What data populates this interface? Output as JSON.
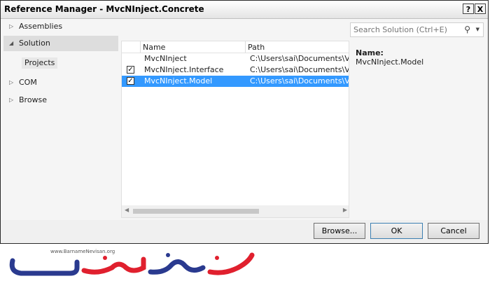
{
  "window": {
    "title": "Reference Manager - MvcNInject.Concrete",
    "help_btn": "?",
    "close_btn": "X"
  },
  "nav": {
    "items": [
      {
        "label": "Assemblies",
        "arrow": "▷"
      },
      {
        "label": "Solution",
        "arrow": "◢"
      },
      {
        "label": "COM",
        "arrow": "▷"
      },
      {
        "label": "Browse",
        "arrow": "▷"
      }
    ],
    "sub_item": "Projects"
  },
  "list": {
    "columns": [
      "Name",
      "Path"
    ],
    "rows": [
      {
        "checked": false,
        "name": "MvcNInject",
        "path": "C:\\Users\\sai\\Documents\\Visua"
      },
      {
        "checked": true,
        "name": "MvcNInject.Interface",
        "path": "C:\\Users\\sai\\Documents\\Visua"
      },
      {
        "checked": true,
        "name": "MvcNInject.Model",
        "path": "C:\\Users\\sai\\Documents\\Visua"
      }
    ],
    "check_glyph": "✓"
  },
  "search": {
    "placeholder": "Search Solution (Ctrl+E)"
  },
  "details": {
    "label": "Name:",
    "value": "MvcNInject.Model"
  },
  "footer": {
    "browse": "Browse...",
    "ok": "OK",
    "cancel": "Cancel"
  },
  "watermark": {
    "url": "www.BarnameNevisan.org",
    "logo_text": "برنامه نویسان"
  },
  "colors": {
    "selection": "#3399ff",
    "logo_red": "#e0202e",
    "logo_blue": "#2a3a8f"
  }
}
